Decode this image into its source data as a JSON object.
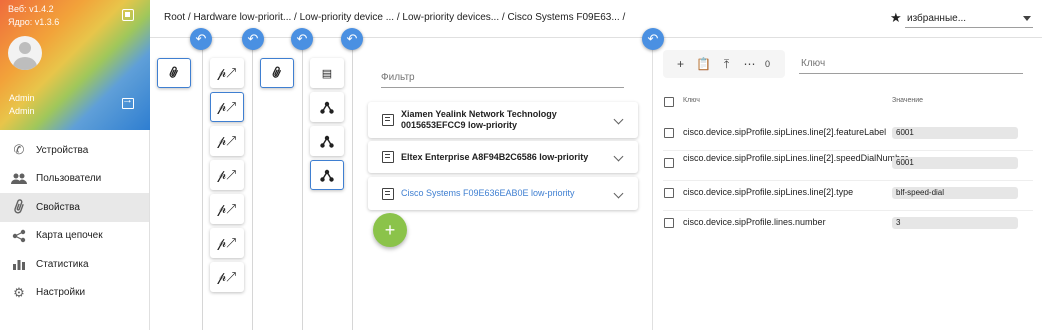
{
  "sidebar": {
    "web_version": "Веб: v1.4.2",
    "core_version": "Ядро: v1.3.6",
    "user_name": "Admin",
    "user_role": "Admin",
    "nav": [
      {
        "label": "Устройства",
        "icon": "phone-icon"
      },
      {
        "label": "Пользователи",
        "icon": "users-icon"
      },
      {
        "label": "Свойства",
        "icon": "paperclip-icon",
        "active": true
      },
      {
        "label": "Карта цепочек",
        "icon": "share-icon"
      },
      {
        "label": "Статистика",
        "icon": "bar-chart-icon"
      },
      {
        "label": "Настройки",
        "icon": "gear-icon"
      }
    ]
  },
  "header": {
    "breadcrumb": "Root / Hardware low-priorit... / Low-priority device ... / Low-priority devices... / Cisco Systems F09E63... /",
    "favorites": "избранные..."
  },
  "devices": {
    "filter_placeholder": "Фильтр",
    "items": [
      {
        "name": "Xiamen Yealink Network Technology 0015653EFCC9 low-priority"
      },
      {
        "name": "Eltex Enterprise A8F94B2C6586 low-priority"
      },
      {
        "name": "Cisco Systems F09E636EAB0E low-priority",
        "selected": true
      }
    ],
    "add_label": "+"
  },
  "properties": {
    "toolbar_count": "0",
    "key_placeholder": "Ключ",
    "col_key": "Ключ",
    "col_value": "Значение",
    "rows": [
      {
        "key": "cisco.device.sipProfile.sipLines.line[2].featureLabel",
        "value": "6001"
      },
      {
        "key": "cisco.device.sipProfile.sipLines.line[2].speedDialNumber",
        "value": "6001"
      },
      {
        "key": "cisco.device.sipProfile.sipLines.line[2].type",
        "value": "blf-speed-dial"
      },
      {
        "key": "cisco.device.sipProfile.lines.number",
        "value": "3"
      }
    ]
  },
  "colors": {
    "accent": "#4a90e2",
    "fab": "#8bc34a",
    "selected_text": "#3f7fd1"
  }
}
